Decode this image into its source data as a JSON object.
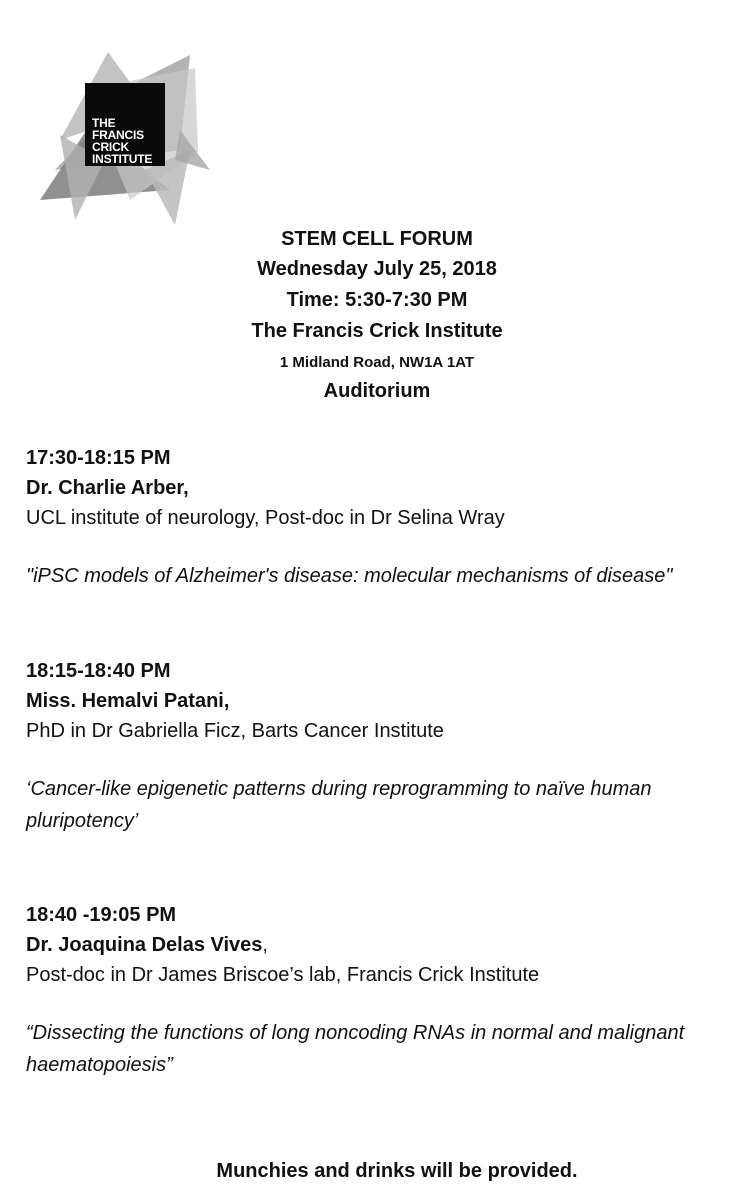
{
  "logo": {
    "lines": [
      "THE",
      "FRANCIS",
      "CRICK",
      "INSTITUTE"
    ],
    "icon": "francis-crick-logo"
  },
  "event": {
    "title": "STEM CELL FORUM",
    "date": "Wednesday July 25, 2018",
    "time": "Time: 5:30-7:30 PM",
    "venue": "The Francis Crick Institute",
    "address": "1 Midland Road, NW1A 1AT",
    "room": "Auditorium"
  },
  "talks": [
    {
      "time": "17:30-18:15 PM",
      "speaker": "Dr. Charlie Arber,",
      "affiliation": "UCL institute of neurology, Post-doc in Dr Selina Wray",
      "title": " \"iPSC models of Alzheimer's disease: molecular mechanisms of disease\""
    },
    {
      "time": "18:15-18:40 PM",
      "speaker": "Miss. Hemalvi Patani,",
      "affiliation": "PhD in Dr Gabriella Ficz, Barts Cancer Institute",
      "title": "‘Cancer-like epigenetic patterns during reprogramming to naïve human pluripotency’"
    },
    {
      "time": "18:40 -19:05 PM",
      "speaker": "Dr. Joaquina Delas Vives",
      "speaker_suffix": ",",
      "affiliation": "Post-doc in Dr James Briscoe’s lab, Francis Crick Institute",
      "title": "“Dissecting the functions of long noncoding RNAs in normal and malignant haematopoiesis”"
    }
  ],
  "footer": "Munchies and drinks will be provided."
}
